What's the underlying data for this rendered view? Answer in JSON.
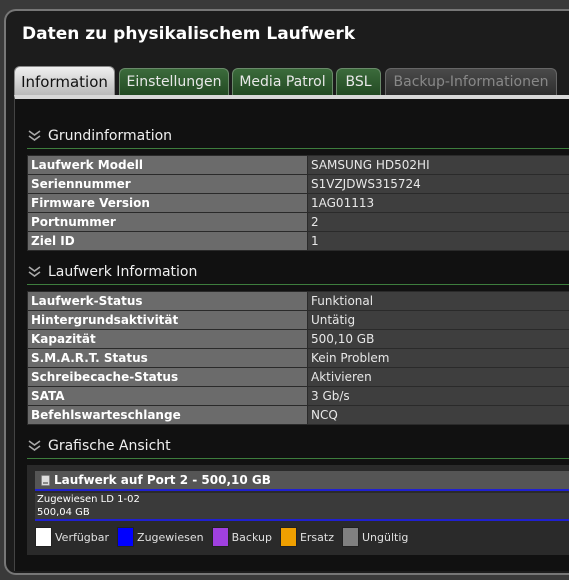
{
  "window": {
    "title": "Daten zu physikalischem Laufwerk"
  },
  "tabs": [
    {
      "label": "Information",
      "state": "active"
    },
    {
      "label": "Einstellungen",
      "state": "normal"
    },
    {
      "label": "Media Patrol",
      "state": "normal"
    },
    {
      "label": "BSL",
      "state": "normal"
    },
    {
      "label": "Backup-Informationen",
      "state": "disabled"
    }
  ],
  "sections": {
    "basic": {
      "title": "Grundinformation",
      "rows": [
        {
          "key": "Laufwerk Modell",
          "value": "SAMSUNG HD502HI"
        },
        {
          "key": "Seriennummer",
          "value": "S1VZJDWS315724"
        },
        {
          "key": "Firmware Version",
          "value": "1AG01113"
        },
        {
          "key": "Portnummer",
          "value": "2"
        },
        {
          "key": "Ziel ID",
          "value": "1"
        }
      ]
    },
    "drive": {
      "title": "Laufwerk Information",
      "rows": [
        {
          "key": "Laufwerk-Status",
          "value": "Funktional"
        },
        {
          "key": "Hintergrundsaktivität",
          "value": "Untätig"
        },
        {
          "key": "Kapazität",
          "value": "500,10 GB"
        },
        {
          "key": "S.M.A.R.T. Status",
          "value": "Kein Problem"
        },
        {
          "key": "Schreibecache-Status",
          "value": "Aktivieren"
        },
        {
          "key": "SATA",
          "value": "3 Gb/s"
        },
        {
          "key": "Befehlswarteschlange",
          "value": "NCQ"
        }
      ]
    },
    "graph": {
      "title": "Grafische Ansicht",
      "drive_label": "Laufwerk auf Port 2 - 500,10 GB",
      "assigned_line1": "Zugewiesen LD 1-02",
      "assigned_line2": "500,04 GB",
      "legend": [
        {
          "label": "Verfügbar",
          "color": "#ffffff"
        },
        {
          "label": "Zugewiesen",
          "color": "#0000ff"
        },
        {
          "label": "Backup",
          "color": "#a040e0"
        },
        {
          "label": "Ersatz",
          "color": "#f0a000"
        },
        {
          "label": "Ungültig",
          "color": "#808080"
        }
      ]
    }
  },
  "colors": {
    "tab_green": "#2e5e2e",
    "section_rule": "#3d7d3d",
    "assigned_border": "#2020d0"
  }
}
